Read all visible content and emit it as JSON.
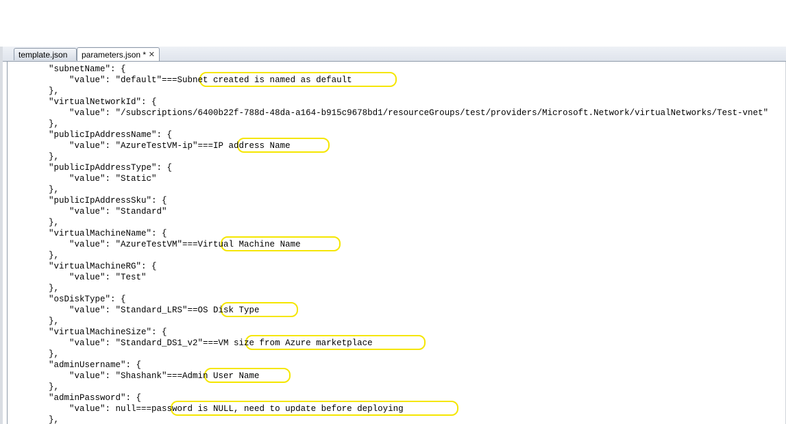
{
  "tabs": [
    {
      "label": "template.json"
    },
    {
      "label": "parameters.json *",
      "close": "✕"
    }
  ],
  "code_lines": [
    "        \"subnetName\": {",
    "            \"value\": \"default\"===Subnet created is named as default",
    "        },",
    "        \"virtualNetworkId\": {",
    "            \"value\": \"/subscriptions/6400b22f-788d-48da-a164-b915c9678bd1/resourceGroups/test/providers/Microsoft.Network/virtualNetworks/Test-vnet\"",
    "        },",
    "        \"publicIpAddressName\": {",
    "            \"value\": \"AzureTestVM-ip\"===IP address Name",
    "        },",
    "        \"publicIpAddressType\": {",
    "            \"value\": \"Static\"",
    "        },",
    "        \"publicIpAddressSku\": {",
    "            \"value\": \"Standard\"",
    "        },",
    "        \"virtualMachineName\": {",
    "            \"value\": \"AzureTestVM\"===Virtual Machine Name",
    "        },",
    "        \"virtualMachineRG\": {",
    "            \"value\": \"Test\"",
    "        },",
    "        \"osDiskType\": {",
    "            \"value\": \"Standard_LRS\"==OS Disk Type",
    "        },",
    "        \"virtualMachineSize\": {",
    "            \"value\": \"Standard_DS1_v2\"===VM size from Azure marketplace",
    "        },",
    "        \"adminUsername\": {",
    "            \"value\": \"Shashank\"===Admin User Name",
    "        },",
    "        \"adminPassword\": {",
    "            \"value\": null===password is NULL, need to update before deploying",
    "        },"
  ],
  "colors": {
    "highlight": "#f5e600",
    "tab_border": "#8e9aa9"
  }
}
